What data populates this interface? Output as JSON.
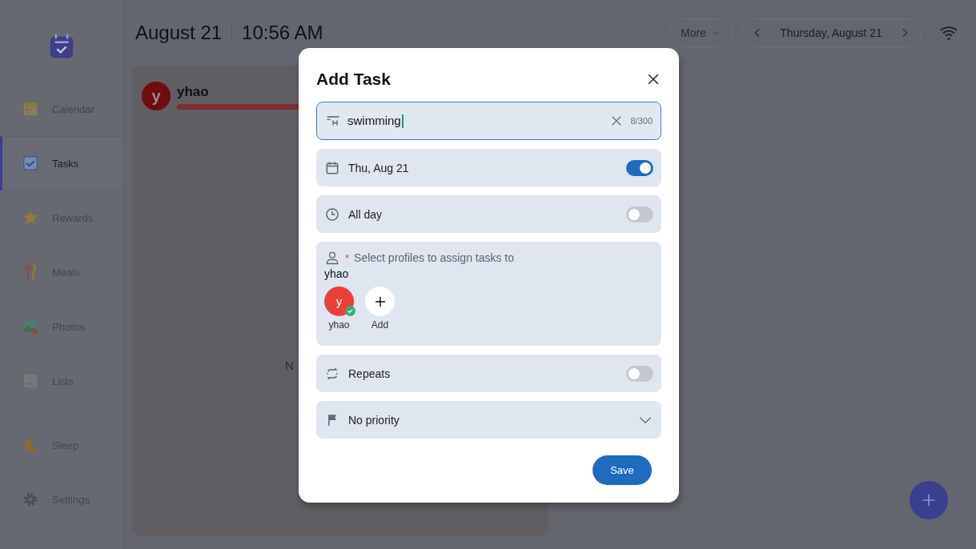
{
  "sidebar": {
    "items": [
      {
        "label": "Calendar",
        "selected": false
      },
      {
        "label": "Tasks",
        "selected": true
      },
      {
        "label": "Rewards",
        "selected": false
      },
      {
        "label": "Meals",
        "selected": false
      },
      {
        "label": "Photos",
        "selected": false
      },
      {
        "label": "Lists",
        "selected": false
      },
      {
        "label": "Sleep",
        "selected": false
      },
      {
        "label": "Settings",
        "selected": false
      }
    ]
  },
  "header": {
    "date": "August 21",
    "time": "10:56 AM",
    "more_button": "More",
    "date_nav": "Thursday, August 21"
  },
  "profile_card": {
    "initial": "y",
    "name": "yhao",
    "empty_text": "N"
  },
  "dialog": {
    "title": "Add Task",
    "task_field": {
      "value": "swimming",
      "counter": "8/300"
    },
    "rows": [
      {
        "kind": "toggle",
        "label": "Thu, Aug 21",
        "on": true
      },
      {
        "kind": "toggle",
        "label": "All day",
        "on": false
      },
      {
        "kind": "profiles",
        "required_mark": "*",
        "prompt": "Select profiles to assign tasks to",
        "assigned": "yhao",
        "profiles": [
          {
            "initial": "y",
            "name": "yhao",
            "selected": true
          }
        ],
        "add_label": "Add"
      },
      {
        "kind": "toggle",
        "label": "Repeats",
        "on": false
      },
      {
        "kind": "select",
        "label": "No priority"
      }
    ],
    "save_button": "Save"
  }
}
